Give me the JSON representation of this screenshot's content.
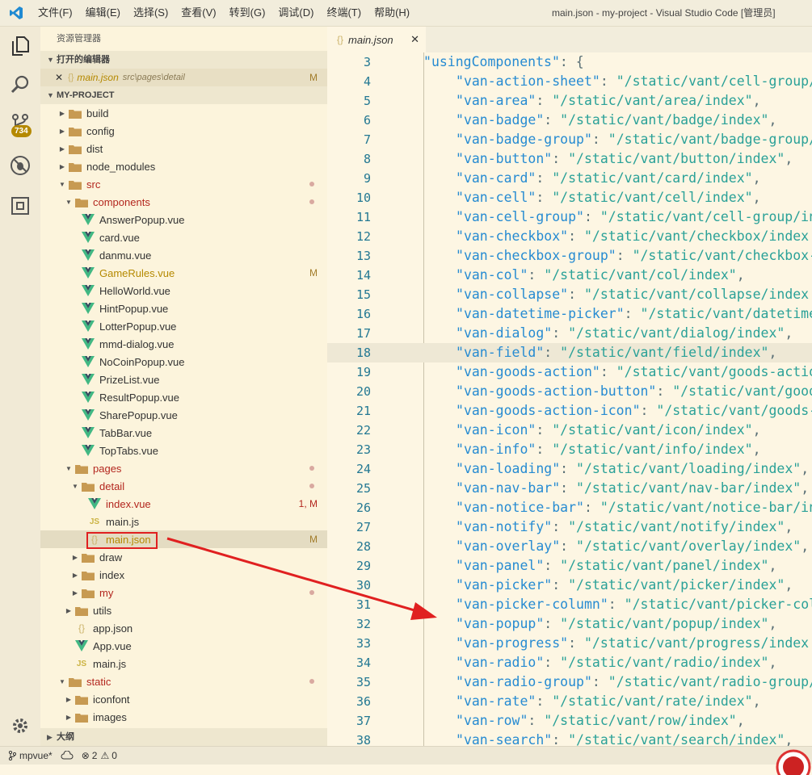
{
  "titlebar": {
    "menu": [
      "文件(F)",
      "编辑(E)",
      "选择(S)",
      "查看(V)",
      "转到(G)",
      "调试(D)",
      "终端(T)",
      "帮助(H)"
    ],
    "window_title": "main.json - my-project - Visual Studio Code [管理员]"
  },
  "activity": {
    "badge": "734"
  },
  "sidebar": {
    "title": "资源管理器",
    "open_editors_header": "打开的编辑器",
    "open_editor": {
      "name": "main.json",
      "path": "src\\pages\\detail",
      "status": "M"
    },
    "project_header": "MY-PROJECT",
    "outline_header": "大纲",
    "tree": [
      {
        "label": "build",
        "type": "folder",
        "depth": 0,
        "expanded": false
      },
      {
        "label": "config",
        "type": "folder",
        "depth": 0,
        "expanded": false
      },
      {
        "label": "dist",
        "type": "folder",
        "depth": 0,
        "expanded": false
      },
      {
        "label": "node_modules",
        "type": "folder",
        "depth": 0,
        "expanded": false
      },
      {
        "label": "src",
        "type": "folder",
        "depth": 0,
        "expanded": true,
        "dot": true,
        "red": true
      },
      {
        "label": "components",
        "type": "folder",
        "depth": 1,
        "expanded": true,
        "dot": true,
        "red": true
      },
      {
        "label": "AnswerPopup.vue",
        "type": "vue",
        "depth": 2
      },
      {
        "label": "card.vue",
        "type": "vue",
        "depth": 2
      },
      {
        "label": "danmu.vue",
        "type": "vue",
        "depth": 2
      },
      {
        "label": "GameRules.vue",
        "type": "vue",
        "depth": 2,
        "status": "M",
        "mod": true
      },
      {
        "label": "HelloWorld.vue",
        "type": "vue",
        "depth": 2
      },
      {
        "label": "HintPopup.vue",
        "type": "vue",
        "depth": 2
      },
      {
        "label": "LotterPopup.vue",
        "type": "vue",
        "depth": 2
      },
      {
        "label": "mmd-dialog.vue",
        "type": "vue",
        "depth": 2
      },
      {
        "label": "NoCoinPopup.vue",
        "type": "vue",
        "depth": 2
      },
      {
        "label": "PrizeList.vue",
        "type": "vue",
        "depth": 2
      },
      {
        "label": "ResultPopup.vue",
        "type": "vue",
        "depth": 2
      },
      {
        "label": "SharePopup.vue",
        "type": "vue",
        "depth": 2
      },
      {
        "label": "TabBar.vue",
        "type": "vue",
        "depth": 2
      },
      {
        "label": "TopTabs.vue",
        "type": "vue",
        "depth": 2
      },
      {
        "label": "pages",
        "type": "folder",
        "depth": 1,
        "expanded": true,
        "dot": true,
        "red": true
      },
      {
        "label": "detail",
        "type": "folder",
        "depth": 2,
        "expanded": true,
        "dot": true,
        "red": true
      },
      {
        "label": "index.vue",
        "type": "vue",
        "depth": 3,
        "status": "1, M",
        "red": true
      },
      {
        "label": "main.js",
        "type": "js",
        "depth": 3
      },
      {
        "label": "main.json",
        "type": "json",
        "depth": 3,
        "status": "M",
        "selected": true,
        "mod": true
      },
      {
        "label": "draw",
        "type": "folder",
        "depth": 2,
        "expanded": false
      },
      {
        "label": "index",
        "type": "folder",
        "depth": 2,
        "expanded": false
      },
      {
        "label": "my",
        "type": "folder",
        "depth": 2,
        "expanded": false,
        "dot": true,
        "red": true
      },
      {
        "label": "utils",
        "type": "folder",
        "depth": 1,
        "expanded": false
      },
      {
        "label": "app.json",
        "type": "json",
        "depth": 1
      },
      {
        "label": "App.vue",
        "type": "vue",
        "depth": 1
      },
      {
        "label": "main.js",
        "type": "js",
        "depth": 1
      },
      {
        "label": "static",
        "type": "folder",
        "depth": 0,
        "expanded": true,
        "dot": true,
        "red": true
      },
      {
        "label": "iconfont",
        "type": "folder",
        "depth": 1,
        "expanded": false
      },
      {
        "label": "images",
        "type": "folder",
        "depth": 1,
        "expanded": false
      }
    ]
  },
  "editor": {
    "tab_label": "main.json",
    "active_line": 18,
    "lines": [
      {
        "n": "3",
        "indent": 0,
        "key": "usingComponents",
        "val": "",
        "tail": ": {"
      },
      {
        "n": "4",
        "indent": 1,
        "key": "van-action-sheet",
        "val": "/static/vant/cell-group/",
        "tail": ""
      },
      {
        "n": "5",
        "indent": 1,
        "key": "van-area",
        "val": "/static/vant/area/index",
        "tail": ","
      },
      {
        "n": "6",
        "indent": 1,
        "key": "van-badge",
        "val": "/static/vant/badge/index",
        "tail": ","
      },
      {
        "n": "7",
        "indent": 1,
        "key": "van-badge-group",
        "val": "/static/vant/badge-group/",
        "tail": ""
      },
      {
        "n": "8",
        "indent": 1,
        "key": "van-button",
        "val": "/static/vant/button/index",
        "tail": ","
      },
      {
        "n": "9",
        "indent": 1,
        "key": "van-card",
        "val": "/static/vant/card/index",
        "tail": ","
      },
      {
        "n": "10",
        "indent": 1,
        "key": "van-cell",
        "val": "/static/vant/cell/index",
        "tail": ","
      },
      {
        "n": "11",
        "indent": 1,
        "key": "van-cell-group",
        "val": "/static/vant/cell-group/in",
        "tail": ""
      },
      {
        "n": "12",
        "indent": 1,
        "key": "van-checkbox",
        "val": "/static/vant/checkbox/index",
        "tail": ""
      },
      {
        "n": "13",
        "indent": 1,
        "key": "van-checkbox-group",
        "val": "/static/vant/checkbox-",
        "tail": ""
      },
      {
        "n": "14",
        "indent": 1,
        "key": "van-col",
        "val": "/static/vant/col/index",
        "tail": ","
      },
      {
        "n": "15",
        "indent": 1,
        "key": "van-collapse",
        "val": "/static/vant/collapse/index",
        "tail": ""
      },
      {
        "n": "16",
        "indent": 1,
        "key": "van-datetime-picker",
        "val": "/static/vant/datetime",
        "tail": ""
      },
      {
        "n": "17",
        "indent": 1,
        "key": "van-dialog",
        "val": "/static/vant/dialog/index",
        "tail": ","
      },
      {
        "n": "18",
        "indent": 1,
        "key": "van-field",
        "val": "/static/vant/field/index",
        "tail": ","
      },
      {
        "n": "19",
        "indent": 1,
        "key": "van-goods-action",
        "val": "/static/vant/goods-actio",
        "tail": ""
      },
      {
        "n": "20",
        "indent": 1,
        "key": "van-goods-action-button",
        "val": "/static/vant/good",
        "tail": ""
      },
      {
        "n": "21",
        "indent": 1,
        "key": "van-goods-action-icon",
        "val": "/static/vant/goods-",
        "tail": ""
      },
      {
        "n": "22",
        "indent": 1,
        "key": "van-icon",
        "val": "/static/vant/icon/index",
        "tail": ","
      },
      {
        "n": "23",
        "indent": 1,
        "key": "van-info",
        "val": "/static/vant/info/index",
        "tail": ","
      },
      {
        "n": "24",
        "indent": 1,
        "key": "van-loading",
        "val": "/static/vant/loading/index",
        "tail": ","
      },
      {
        "n": "25",
        "indent": 1,
        "key": "van-nav-bar",
        "val": "/static/vant/nav-bar/index",
        "tail": ","
      },
      {
        "n": "26",
        "indent": 1,
        "key": "van-notice-bar",
        "val": "/static/vant/notice-bar/in",
        "tail": ""
      },
      {
        "n": "27",
        "indent": 1,
        "key": "van-notify",
        "val": "/static/vant/notify/index",
        "tail": ","
      },
      {
        "n": "28",
        "indent": 1,
        "key": "van-overlay",
        "val": "/static/vant/overlay/index",
        "tail": ","
      },
      {
        "n": "29",
        "indent": 1,
        "key": "van-panel",
        "val": "/static/vant/panel/index",
        "tail": ","
      },
      {
        "n": "30",
        "indent": 1,
        "key": "van-picker",
        "val": "/static/vant/picker/index",
        "tail": ","
      },
      {
        "n": "31",
        "indent": 1,
        "key": "van-picker-column",
        "val": "/static/vant/picker-col",
        "tail": ""
      },
      {
        "n": "32",
        "indent": 1,
        "key": "van-popup",
        "val": "/static/vant/popup/index",
        "tail": ","
      },
      {
        "n": "33",
        "indent": 1,
        "key": "van-progress",
        "val": "/static/vant/progress/index",
        "tail": ""
      },
      {
        "n": "34",
        "indent": 1,
        "key": "van-radio",
        "val": "/static/vant/radio/index",
        "tail": ","
      },
      {
        "n": "35",
        "indent": 1,
        "key": "van-radio-group",
        "val": "/static/vant/radio-group/",
        "tail": ""
      },
      {
        "n": "36",
        "indent": 1,
        "key": "van-rate",
        "val": "/static/vant/rate/index",
        "tail": ","
      },
      {
        "n": "37",
        "indent": 1,
        "key": "van-row",
        "val": "/static/vant/row/index",
        "tail": ","
      },
      {
        "n": "38",
        "indent": 1,
        "key": "van-search",
        "val": "/static/vant/search/index",
        "tail": ","
      }
    ]
  },
  "statusbar": {
    "branch": "mpvue*",
    "errors": "2",
    "warnings": "0"
  },
  "colors": {
    "background": "#fdf6e3",
    "key": "#268bd2",
    "string": "#2aa198",
    "line_number": "#237893",
    "annotation": "#e02020"
  }
}
